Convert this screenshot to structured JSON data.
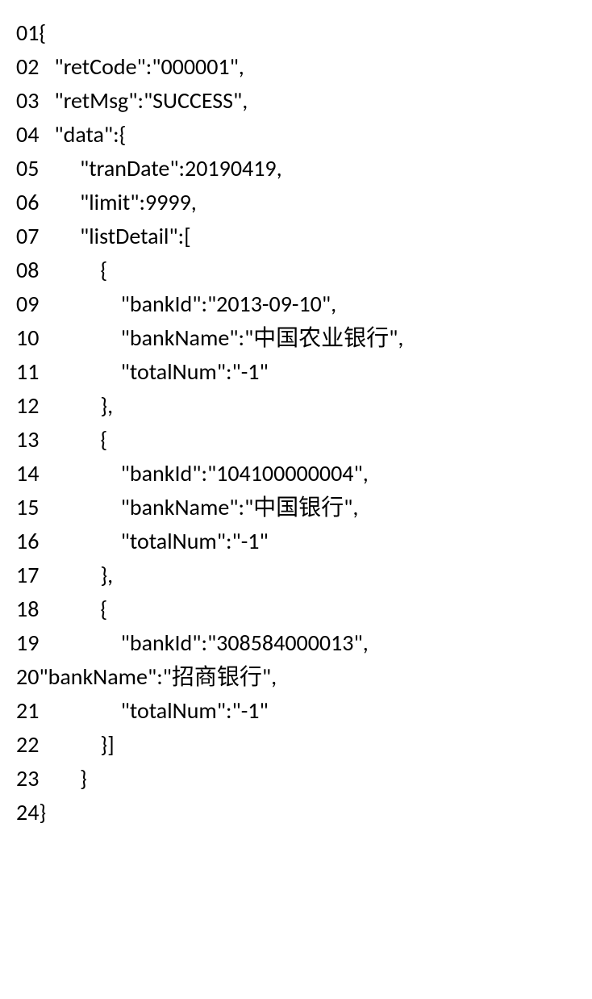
{
  "lines": [
    {
      "no": "01",
      "text": "{"
    },
    {
      "no": "02",
      "text": "   \"retCode\":\"000001\","
    },
    {
      "no": "03",
      "text": "   \"retMsg\":\"SUCCESS\","
    },
    {
      "no": "04",
      "text": "   \"data\":{"
    },
    {
      "no": "05",
      "text": "        \"tranDate\":20190419,"
    },
    {
      "no": "06",
      "text": "        \"limit\":9999,"
    },
    {
      "no": "07",
      "text": "        \"listDetail\":["
    },
    {
      "no": "08",
      "text": "            {"
    },
    {
      "no": "09",
      "text": "                \"bankId\":\"2013-09-10\","
    },
    {
      "no": "10",
      "text": "                \"bankName\":\"中国农业银行\","
    },
    {
      "no": "11",
      "text": "                \"totalNum\":\"-1\""
    },
    {
      "no": "12",
      "text": "            },"
    },
    {
      "no": "13",
      "text": "            {"
    },
    {
      "no": "14",
      "text": "                \"bankId\":\"104100000004\","
    },
    {
      "no": "15",
      "text": "                \"bankName\":\"中国银行\","
    },
    {
      "no": "16",
      "text": "                \"totalNum\":\"-1\""
    },
    {
      "no": "17",
      "text": "            },"
    },
    {
      "no": "18",
      "text": "            {"
    },
    {
      "no": "19",
      "text": "                \"bankId\":\"308584000013\","
    },
    {
      "no": "20",
      "text": "\"bankName\":\"招商银行\","
    },
    {
      "no": "21",
      "text": "                \"totalNum\":\"-1\""
    },
    {
      "no": "22",
      "text": "            }]"
    },
    {
      "no": "23",
      "text": "        }"
    },
    {
      "no": "24",
      "text": "}"
    }
  ]
}
